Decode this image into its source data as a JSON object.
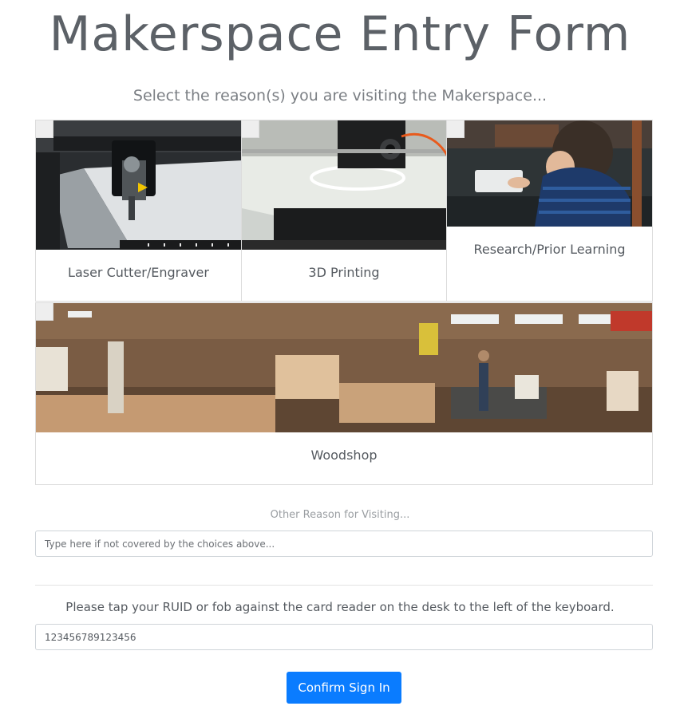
{
  "page": {
    "title": "Makerspace Entry Form",
    "subtitle": "Select the reason(s) you are visiting the Makerspace..."
  },
  "reasons": [
    {
      "label": "Laser Cutter/Engraver",
      "image": "laser-cutter-photo",
      "checked": false
    },
    {
      "label": "3D Printing",
      "image": "3d-printer-photo",
      "checked": false
    },
    {
      "label": "Research/Prior Learning",
      "image": "child-tablet-photo",
      "checked": false
    },
    {
      "label": "Woodshop",
      "image": "woodshop-photo",
      "checked": false
    }
  ],
  "other_reason": {
    "label": "Other Reason for Visiting...",
    "placeholder": "Type here if not covered by the choices above...",
    "value": ""
  },
  "rfid": {
    "instructions": "Please tap your RUID or fob against the card reader on the desk to the left of the keyboard.",
    "value": "123456789123456"
  },
  "confirm_button": {
    "label": "Confirm Sign In"
  },
  "colors": {
    "accent": "#0a7cff",
    "text": "#555a60",
    "border": "#dcdcdc"
  }
}
